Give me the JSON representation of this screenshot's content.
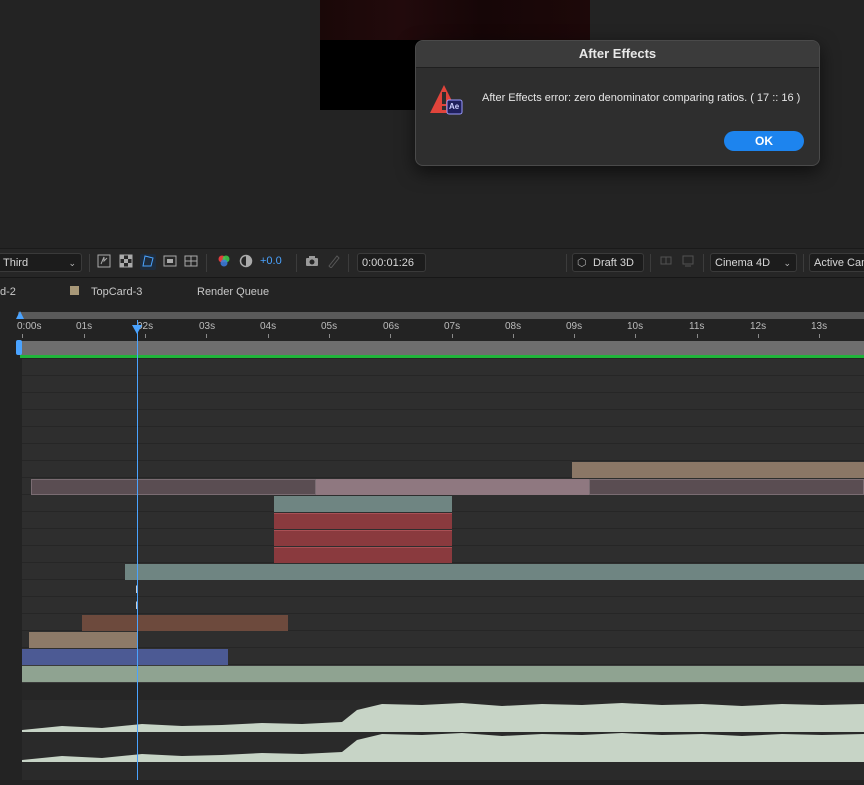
{
  "dialog": {
    "title": "After Effects",
    "message": "After Effects error: zero denominator comparing ratios. ( 17 :: 16 )",
    "ok_label": "OK",
    "icon": "warning-icon",
    "icon_badge": "Ae"
  },
  "toolbar": {
    "view_select": "Third",
    "exposure_value": "+0.0",
    "timecode": "0:00:01:26",
    "renderer_label": "Draft 3D",
    "renderer_select": "Cinema 4D",
    "camera_select": "Active Camera"
  },
  "tabs": [
    "d-2",
    "TopCard-3",
    "Render Queue"
  ],
  "ruler": {
    "ticks": [
      "0:00s",
      "01s",
      "02s",
      "03s",
      "04s",
      "05s",
      "06s",
      "07s",
      "08s",
      "09s",
      "10s",
      "11s",
      "12s",
      "13s"
    ]
  },
  "colors": {
    "accent": "#1d84ee",
    "playhead": "#4aa3ff",
    "work_area_line": "#20b43a",
    "tab_swatch": "#a89878"
  }
}
